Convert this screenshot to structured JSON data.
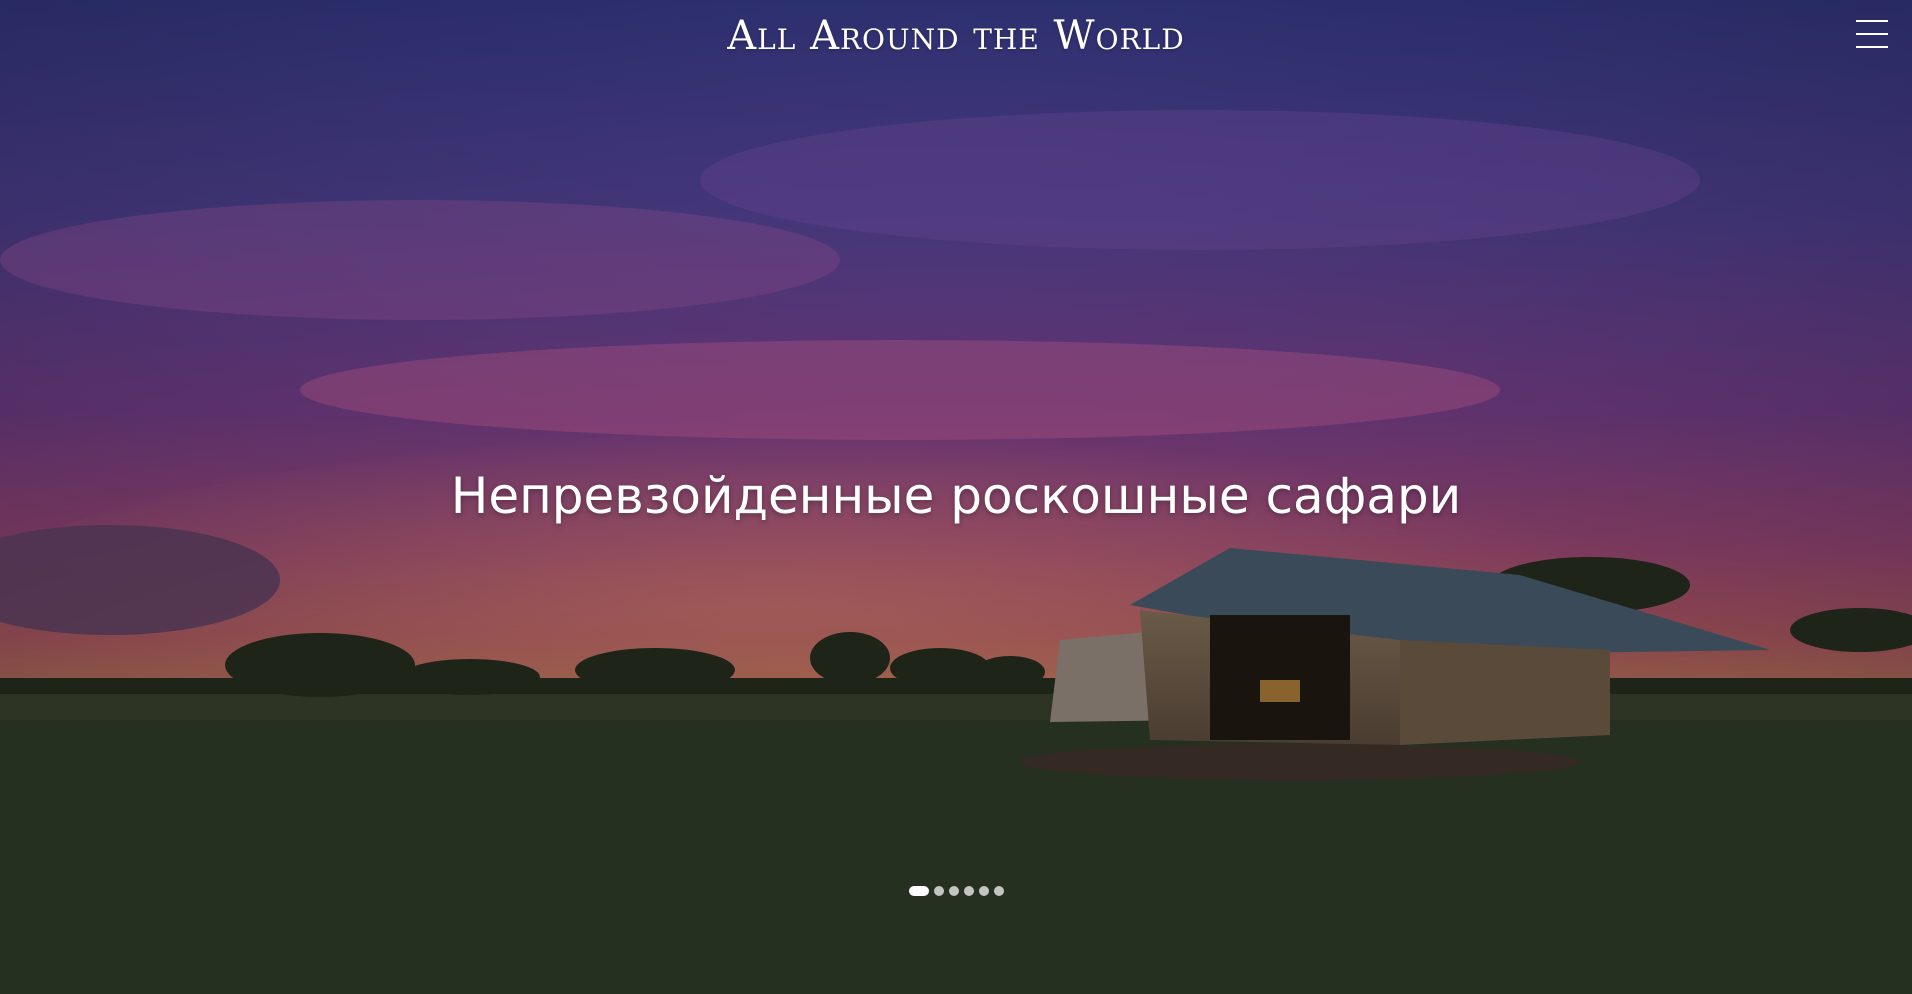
{
  "header": {
    "logo_text": "All Around the World"
  },
  "menu": {
    "icon": "hamburger-menu-icon"
  },
  "hero": {
    "headline": "Непревзойденные роскошные сафари"
  },
  "slider": {
    "slide_count": 6,
    "active_index": 0
  },
  "colors": {
    "sky_top": "#2b2f6e",
    "sky_mid": "#6a3a7e",
    "horizon": "#e0704a",
    "ground": "#2a3020"
  }
}
